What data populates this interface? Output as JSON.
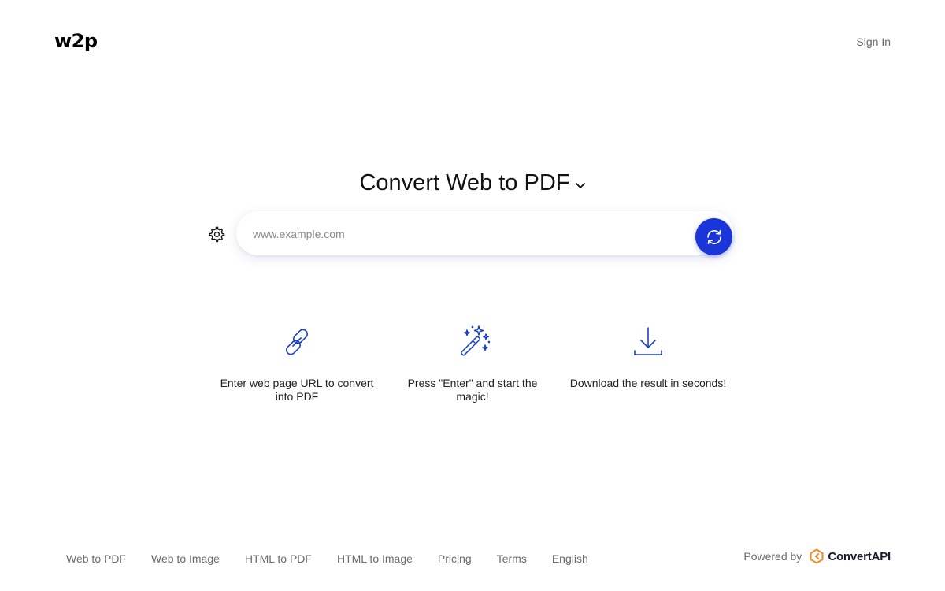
{
  "header": {
    "logo_text": "w2p",
    "signin_label": "Sign In"
  },
  "hero": {
    "title": "Convert Web to PDF",
    "chevron_icon": "chevron-down-icon"
  },
  "search": {
    "placeholder": "www.example.com",
    "value": "",
    "settings_icon": "gear-icon",
    "button_icon": "refresh-icon"
  },
  "steps": [
    {
      "icon": "link-icon",
      "text": "Enter web page URL to convert into PDF"
    },
    {
      "icon": "magic-wand-icon",
      "text": "Press \"Enter\" and start the magic!"
    },
    {
      "icon": "download-icon",
      "text": "Download the result in seconds!"
    }
  ],
  "footer": {
    "links": [
      "Web to PDF",
      "Web to Image",
      "HTML to PDF",
      "HTML to Image",
      "Pricing",
      "Terms",
      "English"
    ],
    "powered_label": "Powered by",
    "brand_name": "ConvertAPI"
  },
  "colors": {
    "accent": "#1a35d8",
    "icon_blue": "#1a3fc8",
    "brand_orange": "#f08a24",
    "muted_text": "#6b6b6b"
  }
}
